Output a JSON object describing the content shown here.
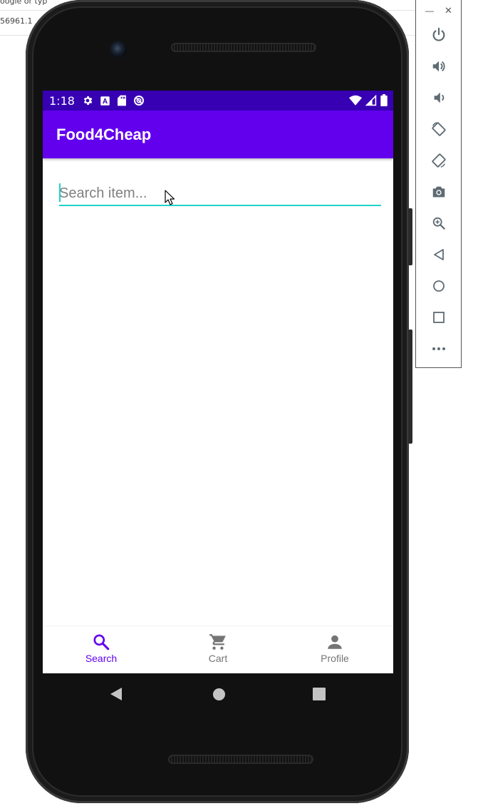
{
  "background": {
    "text_top": "oogle or typ",
    "text_addr": "56961.1"
  },
  "status_bar": {
    "time": "1:18",
    "color": "#3700b3",
    "left_icons": [
      "gear-icon",
      "a-box-icon",
      "sd-card-icon",
      "no-sign-icon"
    ],
    "right_icons": [
      "wifi-icon",
      "cell-signal-icon",
      "battery-icon"
    ]
  },
  "app_bar": {
    "title": "Food4Cheap",
    "color": "#6200ee"
  },
  "search": {
    "placeholder": "Search item...",
    "value": "",
    "underline_color": "#1dd3c6"
  },
  "bottom_nav": {
    "items": [
      {
        "label": "Search",
        "icon": "search-icon",
        "active": true
      },
      {
        "label": "Cart",
        "icon": "cart-icon",
        "active": false
      },
      {
        "label": "Profile",
        "icon": "person-icon",
        "active": false
      }
    ],
    "active_color": "#6200ee",
    "inactive_color": "#757575"
  },
  "system_nav": {
    "buttons": [
      "back-icon",
      "home-icon",
      "recents-icon"
    ]
  },
  "emulator_panel": {
    "window_controls": [
      "minimize",
      "close"
    ],
    "tools": [
      {
        "name": "power-icon"
      },
      {
        "name": "volume-up-icon"
      },
      {
        "name": "volume-down-icon"
      },
      {
        "name": "rotate-left-icon"
      },
      {
        "name": "rotate-right-icon"
      },
      {
        "name": "camera-icon"
      },
      {
        "name": "zoom-icon"
      },
      {
        "name": "back-icon"
      },
      {
        "name": "home-icon"
      },
      {
        "name": "overview-icon"
      },
      {
        "name": "more-icon"
      }
    ]
  }
}
